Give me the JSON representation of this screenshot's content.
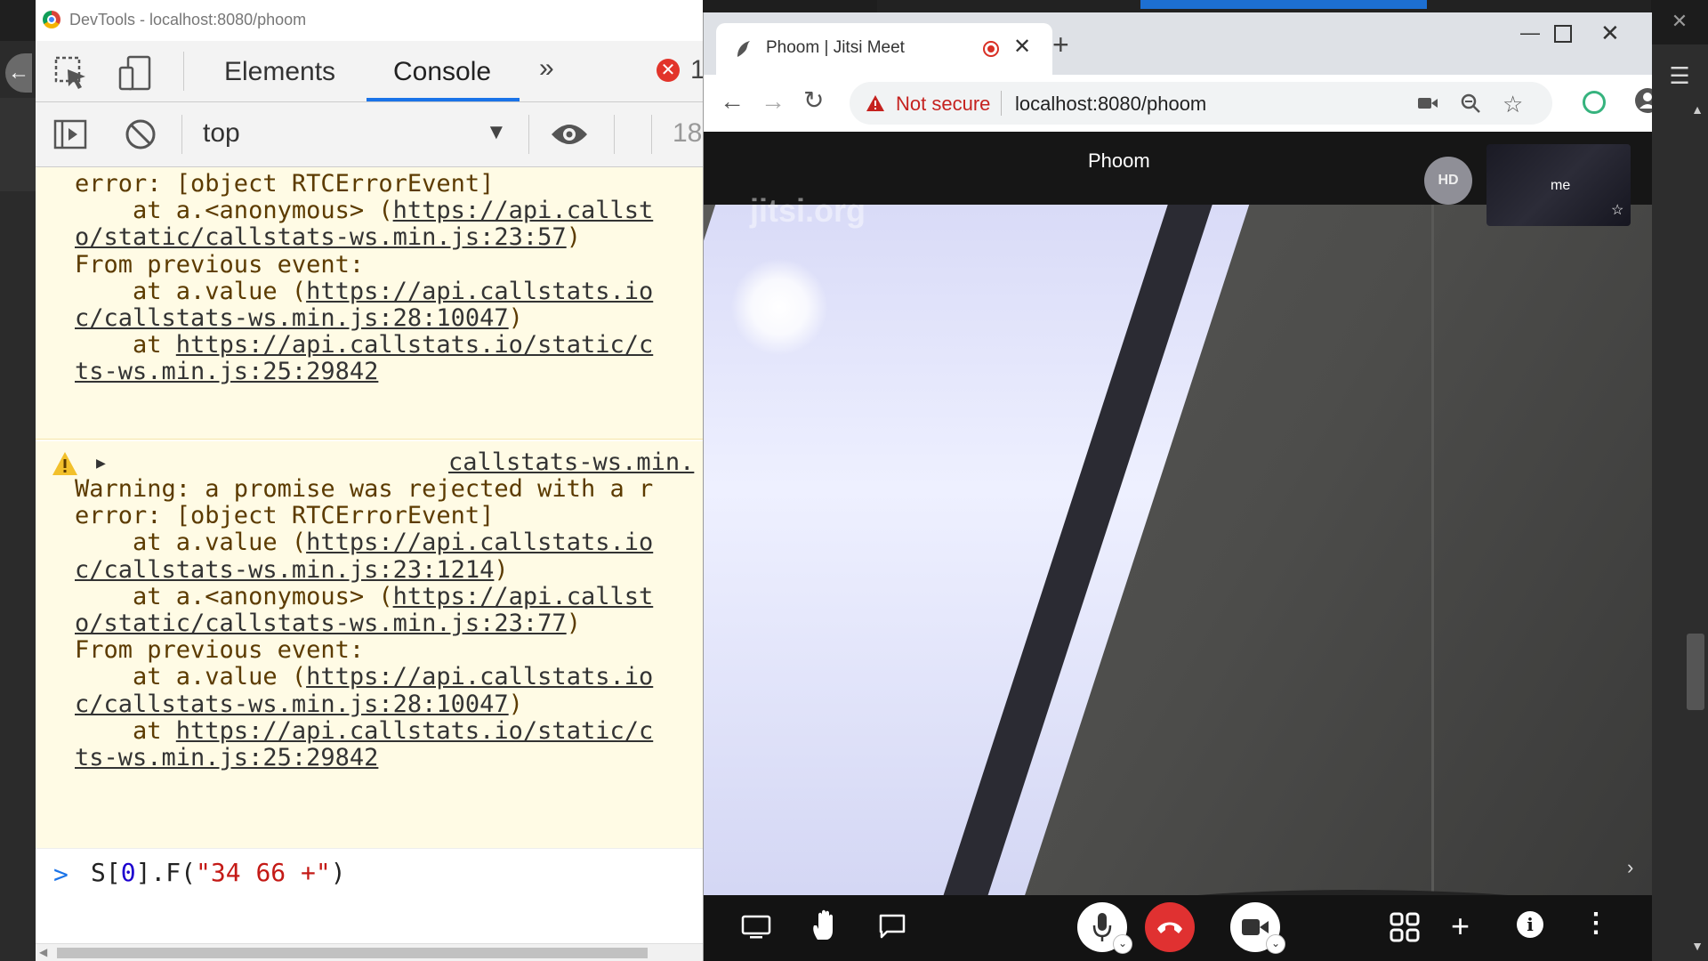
{
  "devtools": {
    "window_title": "DevTools - localhost:8080/phoom",
    "tabs": {
      "elements": "Elements",
      "console": "Console",
      "more": "»"
    },
    "error_count": "1",
    "context": "top",
    "level_count": "18",
    "messages": [
      {
        "lines": [
          [
            {
              "t": "error: [object RTCErrorEvent]"
            }
          ],
          [
            {
              "t": "    at a.<anonymous> ("
            },
            {
              "t": "https://api.callst",
              "link": true
            }
          ],
          [
            {
              "t": "o/static/callstats-ws.min.js:23:57",
              "link": true
            },
            {
              "t": ")"
            }
          ],
          [
            {
              "t": "From previous event:"
            }
          ],
          [
            {
              "t": "    at a.value ("
            },
            {
              "t": "https://api.callstats.io",
              "link": true
            }
          ],
          [
            {
              "t": "c/callstats-ws.min.js:28:10047",
              "link": true
            },
            {
              "t": ")"
            }
          ],
          [
            {
              "t": "    at "
            },
            {
              "t": "https://api.callstats.io/static/c",
              "link": true
            }
          ],
          [
            {
              "t": "ts-ws.min.js:25:29842",
              "link": true
            }
          ]
        ]
      },
      {
        "source": "callstats-ws.min.",
        "lines": [
          [
            {
              "t": "Warning: a promise was rejected with a r"
            }
          ],
          [
            {
              "t": "error: [object RTCErrorEvent]"
            }
          ],
          [
            {
              "t": "    at a.value ("
            },
            {
              "t": "https://api.callstats.io",
              "link": true
            }
          ],
          [
            {
              "t": "c/callstats-ws.min.js:23:1214",
              "link": true
            },
            {
              "t": ")"
            }
          ],
          [
            {
              "t": "    at a.<anonymous> ("
            },
            {
              "t": "https://api.callst",
              "link": true
            }
          ],
          [
            {
              "t": "o/static/callstats-ws.min.js:23:77",
              "link": true
            },
            {
              "t": ")"
            }
          ],
          [
            {
              "t": "From previous event:"
            }
          ],
          [
            {
              "t": "    at a.value ("
            },
            {
              "t": "https://api.callstats.io",
              "link": true
            }
          ],
          [
            {
              "t": "c/callstats-ws.min.js:28:10047",
              "link": true
            },
            {
              "t": ")"
            }
          ],
          [
            {
              "t": "    at "
            },
            {
              "t": "https://api.callstats.io/static/c",
              "link": true
            }
          ],
          [
            {
              "t": "ts-ws.min.js:25:29842",
              "link": true
            }
          ]
        ]
      }
    ],
    "prompt": {
      "chevron": ">",
      "tokens": [
        {
          "t": "S["
        },
        {
          "t": "0",
          "k": "num"
        },
        {
          "t": "].F("
        },
        {
          "t": "\"34 66 +\"",
          "k": "str"
        },
        {
          "t": ")"
        }
      ]
    }
  },
  "browser": {
    "tab_title": "Phoom | Jitsi Meet",
    "not_secure": "Not secure",
    "url": "localhost:8080/phoom",
    "url_host_color": "#222222",
    "recording_color": "#d93025"
  },
  "meeting": {
    "watermark": "jitsi.org",
    "name": "Phoom",
    "quality_badge": "HD",
    "self_label": "me",
    "hangup_color": "#e03131",
    "toolbar_icons": [
      "screenshare-icon",
      "raise-hand-icon",
      "chat-icon",
      "microphone-icon",
      "hangup-icon",
      "camera-icon",
      "tile-view-icon",
      "invite-icon",
      "info-icon",
      "more-icon"
    ]
  },
  "colors": {
    "console_warning_bg": "#fffbe5",
    "console_warning_text": "#5c3b00",
    "devtools_accent": "#1a73e8",
    "error_badge": "#e2342a"
  }
}
